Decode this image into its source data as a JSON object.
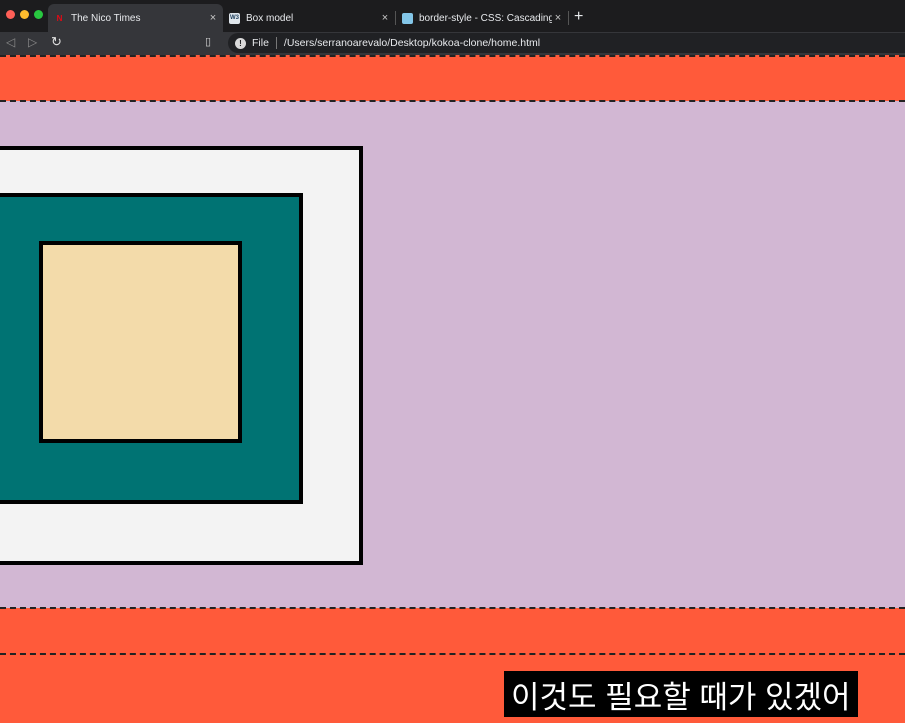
{
  "browser": {
    "tabs": [
      {
        "title": "The Nico Times",
        "favicon": "netflix-n-icon",
        "active": true,
        "favicon_text": "N"
      },
      {
        "title": "Box model",
        "favicon": "w3schools-icon",
        "active": false,
        "favicon_text": "W3"
      },
      {
        "title": "border-style - CSS: Cascading S",
        "favicon": "mdn-icon",
        "active": false,
        "favicon_text": ""
      }
    ],
    "close_glyph": "×",
    "new_tab_glyph": "+",
    "address": {
      "scheme_label": "File",
      "url": "/Users/serranoarevalo/Desktop/kokoa-clone/home.html",
      "info_glyph": "!"
    },
    "nav_icons": {
      "back": "◁",
      "forward": "▷",
      "reload": "↻",
      "bookmark": "▯"
    }
  },
  "colors": {
    "page_bg": "#ff5a3a",
    "content_bg": "#d2b7d3",
    "outer_box": "#f3f3f3",
    "middle_box": "#007373",
    "inner_box": "#f3dbaa"
  },
  "subtitle": "이것도 필요할 때가 있겠어"
}
